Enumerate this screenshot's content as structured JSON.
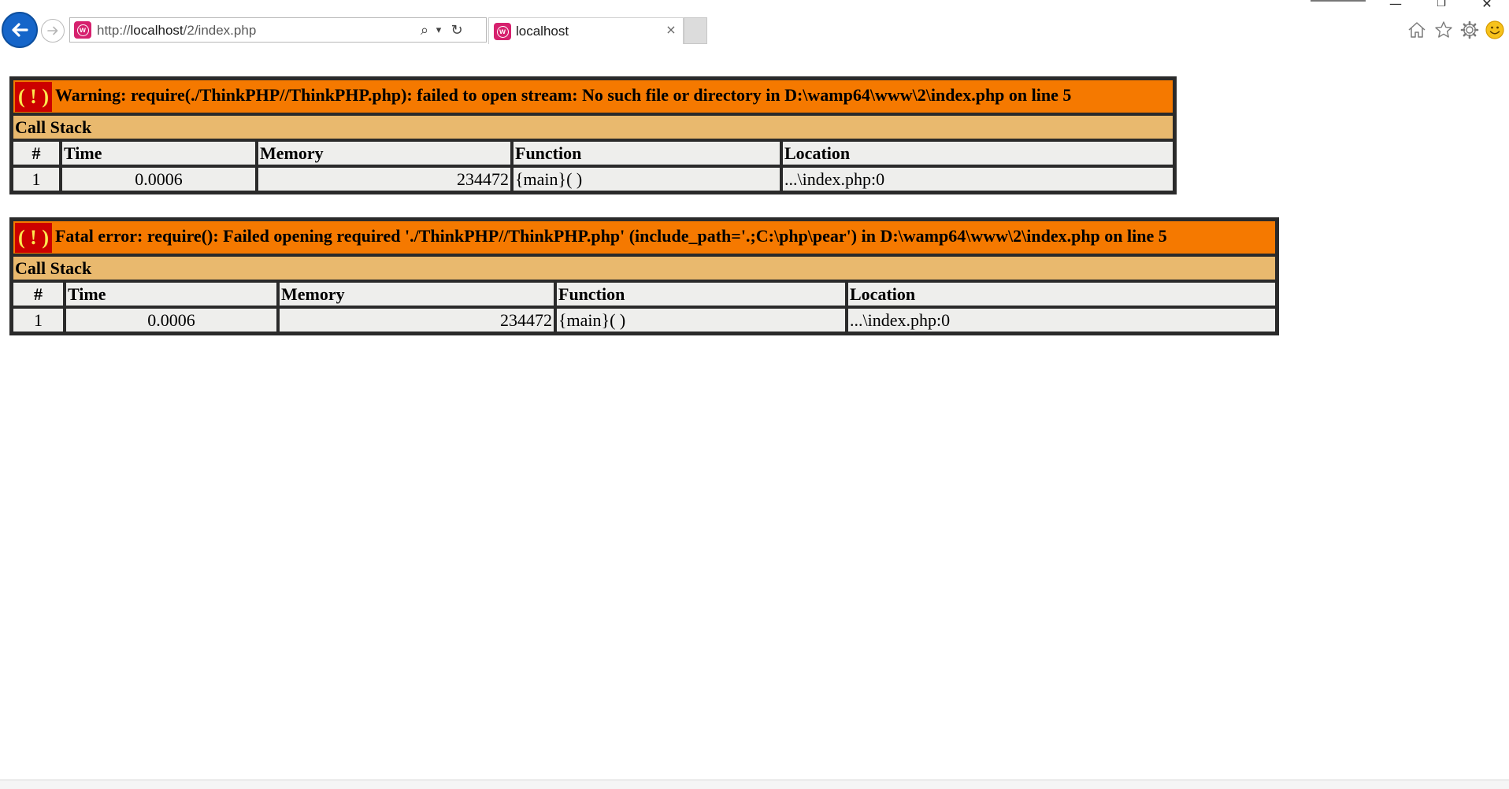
{
  "browser": {
    "address": {
      "scheme": "http://",
      "host": "localhost",
      "path": "/2/index.php"
    },
    "tab_title": "localhost",
    "tab_close": "×",
    "search_glyph": "⌕",
    "dropdown_glyph": "▾",
    "refresh_glyph": "↻",
    "window_controls": {
      "minimize": "—",
      "restore": "❐",
      "close": "✕"
    }
  },
  "errors": [
    {
      "icon": "( ! )",
      "message": "Warning: require(./ThinkPHP//ThinkPHP.php): failed to open stream: No such file or directory in D:\\wamp64\\www\\2\\index.php on line 5",
      "callstack_label": "Call Stack",
      "headers": [
        "#",
        "Time",
        "Memory",
        "Function",
        "Location"
      ],
      "rows": [
        {
          "num": "1",
          "time": "0.0006",
          "memory": "234472",
          "function": "{main}( )",
          "location": "...\\index.php:0"
        }
      ]
    },
    {
      "icon": "( ! )",
      "message": "Fatal error: require(): Failed opening required './ThinkPHP//ThinkPHP.php' (include_path='.;C:\\php\\pear') in D:\\wamp64\\www\\2\\index.php on line 5",
      "callstack_label": "Call Stack",
      "headers": [
        "#",
        "Time",
        "Memory",
        "Function",
        "Location"
      ],
      "rows": [
        {
          "num": "1",
          "time": "0.0006",
          "memory": "234472",
          "function": "{main}( )",
          "location": "...\\index.php:0"
        }
      ]
    }
  ],
  "colors": {
    "message_bg": "#f57900",
    "callstack_bg": "#e9b96e",
    "cell_bg": "#eeeeec",
    "icon_bg": "#cc0000",
    "icon_fg": "#fce94f"
  }
}
